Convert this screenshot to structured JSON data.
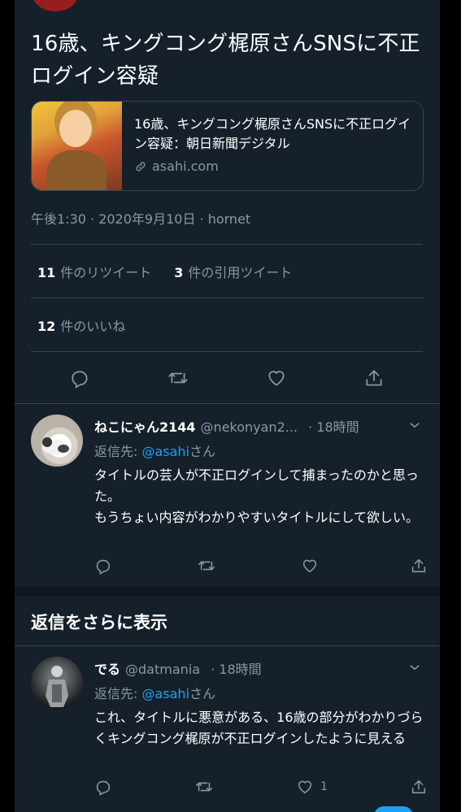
{
  "tweet": {
    "text": "16歳、キングコング梶原さんSNSに不正ログイン容疑",
    "card": {
      "title": "16歳、キングコング梶原さんSNSに不正ログイン容疑：朝日新聞デジタル",
      "domain": "asahi.com"
    },
    "meta": "午後1:30 · 2020年9月10日 · hornet",
    "retweets_count": "11",
    "retweets_label": "件のリツイート",
    "quotes_count": "3",
    "quotes_label": "件の引用ツイート",
    "likes_count": "12",
    "likes_label": "件のいいね"
  },
  "replies": [
    {
      "name": "ねこにゃん2144",
      "handle": "@nekonyan2...",
      "time": "· 18時間",
      "reply_to_prefix": "返信先: ",
      "reply_to_handle": "@asahi",
      "reply_to_suffix": "さん",
      "text": "タイトルの芸人が不正ログインして捕まったのかと思った。\nもうちょい内容がわかりやすいタイトルにして欲しい。",
      "like_count": ""
    },
    {
      "name": "でる",
      "handle": "@datmania",
      "time": "· 18時間",
      "reply_to_prefix": "返信先: ",
      "reply_to_handle": "@asahi",
      "reply_to_suffix": "さん",
      "text": "これ、タイトルに悪意がある、16歳の部分がわかりづらくキングコング梶原が不正ログインしたように見える",
      "like_count": "1"
    }
  ],
  "more_replies_label": "返信をさらに表示",
  "icons": [
    "reply-icon",
    "retweet-icon",
    "like-icon",
    "share-icon",
    "chevron-down-icon",
    "link-icon"
  ],
  "colors": {
    "background": "#15202b",
    "accent": "#1da1f2",
    "muted": "#8899a6",
    "border": "#38444d"
  }
}
